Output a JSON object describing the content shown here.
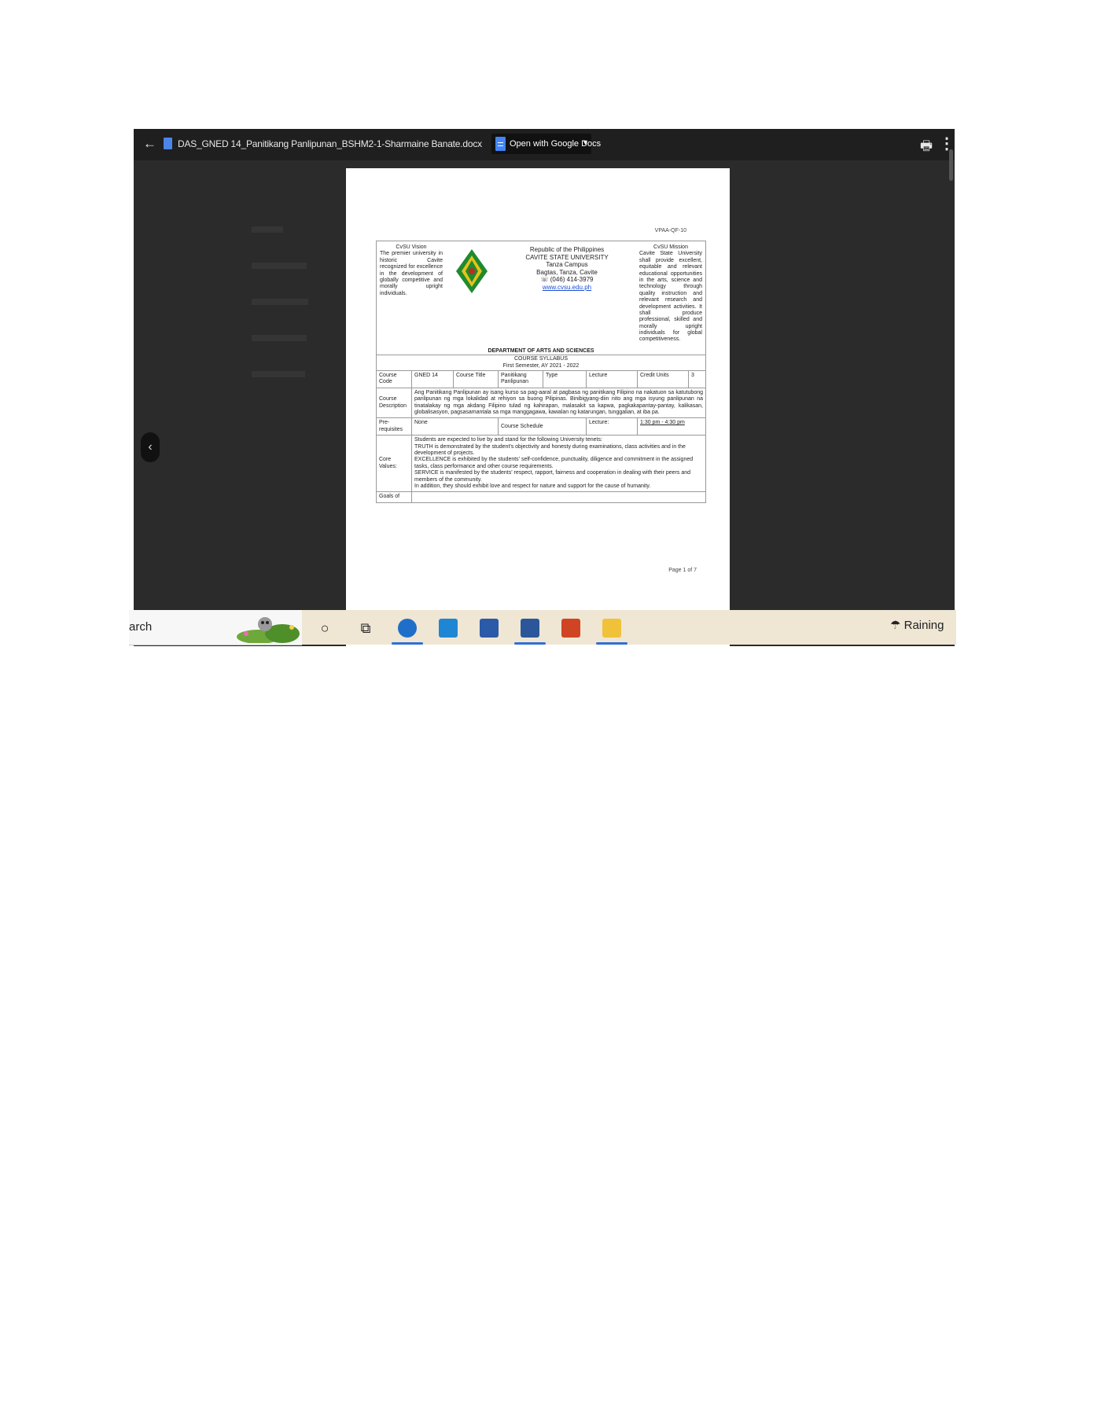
{
  "viewer": {
    "file_name": "DAS_GNED 14_Panitikang Panlipunan_BSHM2-1-Sharmaine Banate.docx",
    "open_with_label": "Open with Google Docs"
  },
  "document": {
    "form_code": "VPAA-QF-10",
    "vision_title": "CvSU Vision",
    "vision_text": "The premier university in historic Cavite recognized for excellence in the development of globally competitive and morally upright individuals.",
    "mission_title": "CvSU Mission",
    "mission_text": "Cavite State University shall provide excellent, equitable and relevant educational opportunities in the arts, science and technology through quality instruction and relevant research and development activities. It shall produce professional, skilled and morally upright individuals for global competitiveness.",
    "republic": "Republic of the Philippines",
    "university": "CAVITE STATE UNIVERSITY",
    "campus": "Tanza Campus",
    "address": "Bagtas, Tanza, Cavite",
    "phone": "☏ (046) 414-3979",
    "website": "www.cvsu.edu.ph",
    "department": "DEPARTMENT OF ARTS AND SCIENCES",
    "syllabus": "COURSE SYLLABUS",
    "semester": "First Semester, AY 2021 - 2022",
    "course_code_label": "Course Code",
    "course_code": "GNED 14",
    "course_title_label": "Course Title",
    "course_title": "Panitikang Panlipunan",
    "type_label": "Type",
    "type_value": "Lecture",
    "credit_units_label": "Credit Units",
    "credit_units": "3",
    "description_label": "Course Description",
    "description": "Ang Panitikang Panlipunan ay isang kurso sa pag-aaral at pagbasa ng panitikang Filipino na nakatuon sa katutubong panlipunan ng mga lokalidad at rehiyon sa buong Pilipinas. Binibigyang-diin nito ang mga isyung panlipunan na tinatalakay ng mga akdang Filipino tulad ng kahirapan, malasakit sa kapwa, pagkakapantay-pantay, kalikasan, globalisasyon, pagsasamantala sa mga manggagawa, kawalan ng katarungan, tunggalian, at iba pa.",
    "prereq_label": "Pre-requisites",
    "prereq": "None",
    "schedule_label": "Course Schedule",
    "lecture_label": "Lecture:",
    "lecture_time": "1:30 pm - 4:30 pm",
    "core_values_label": "Core Values:",
    "core_values_intro": "Students are expected to live by and stand for the following University tenets:",
    "core_truth": "TRUTH is demonstrated by the student's objectivity and honesty during examinations, class activities and in the development of projects.",
    "core_excellence": "EXCELLENCE is exhibited by the students' self-confidence, punctuality, diligence and commitment in the assigned tasks, class performance and other course requirements.",
    "core_service": "SERVICE is manifested by the students' respect, rapport, fairness and cooperation in dealing with their peers and members of the community.",
    "core_addition": "In addition, they should exhibit love and respect for nature and support for the cause of humanity.",
    "goals_label": "Goals of",
    "page_number": "Page 1 of 7"
  },
  "taskbar": {
    "search_text": "arch",
    "weather_text": "Raining"
  },
  "colors": {
    "viewer_bg": "#2b2b2b",
    "taskbar_bg": "#efe6d4",
    "accent": "#2e6fd8"
  }
}
